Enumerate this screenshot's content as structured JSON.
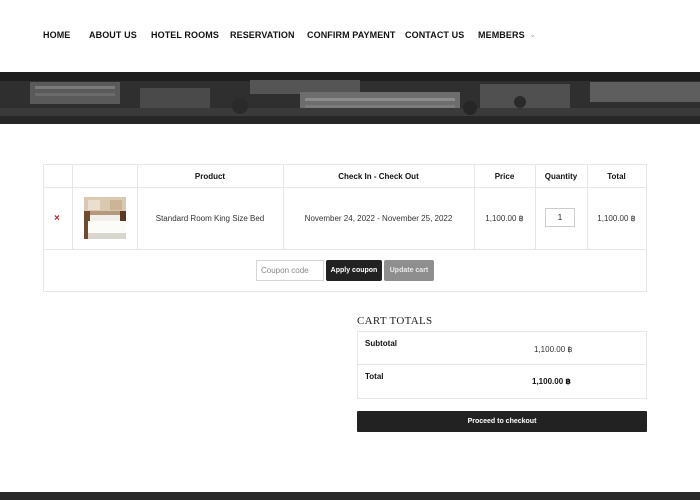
{
  "nav": {
    "home": "HOME",
    "about": "ABOUT US",
    "rooms": "HOTEL ROOMS",
    "reservation": "RESERVATION",
    "confirm_payment": "CONFIRM PAYMENT",
    "contact": "CONTACT US",
    "members": "MEMBERS",
    "members_chevron": "⌄"
  },
  "cart": {
    "headers": {
      "product": "Product",
      "dates": "Check In - Check Out",
      "price": "Price",
      "quantity": "Quantity",
      "total": "Total"
    },
    "item": {
      "remove": "×",
      "name": "Standard Room King Size Bed",
      "dates": "November 24, 2022 - November 25, 2022",
      "price": "1,100.00 ฿",
      "quantity": "1",
      "total": "1,100.00 ฿"
    },
    "coupon_placeholder": "Coupon code",
    "apply_coupon": "Apply coupon",
    "update_cart": "Update cart"
  },
  "totals": {
    "title": "CART TOTALS",
    "subtotal_label": "Subtotal",
    "subtotal_value": "1,100.00 ฿",
    "total_label": "Total",
    "total_value": "1,100.00 ฿",
    "checkout": "Proceed to checkout"
  },
  "colors": {
    "accent_dark": "#222222",
    "remove_red": "#b52a2a",
    "button_disabled": "#8e8e8e"
  }
}
